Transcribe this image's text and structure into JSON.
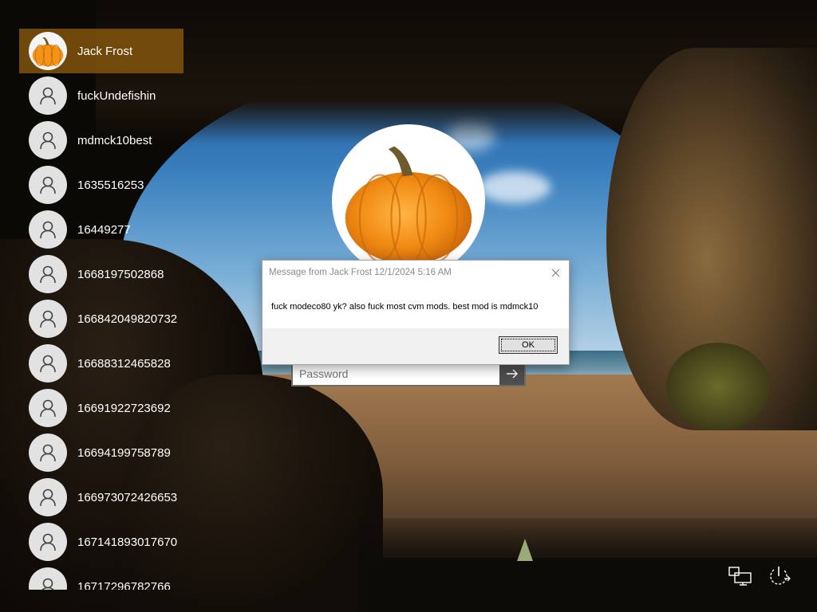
{
  "users": [
    {
      "name": "Jack Frost",
      "selected": true,
      "avatar": "pumpkin"
    },
    {
      "name": "fuckUndefishin",
      "avatar": "person-icon"
    },
    {
      "name": "mdmck10best",
      "avatar": "person-icon"
    },
    {
      "name": "1635516253",
      "avatar": "person-icon"
    },
    {
      "name": "16449277",
      "avatar": "person-icon"
    },
    {
      "name": "1668197502868",
      "avatar": "person-icon"
    },
    {
      "name": "166842049820732",
      "avatar": "person-icon"
    },
    {
      "name": "16688312465828",
      "avatar": "person-icon"
    },
    {
      "name": "16691922723692",
      "avatar": "person-icon"
    },
    {
      "name": "16694199758789",
      "avatar": "person-icon"
    },
    {
      "name": "166973072426653",
      "avatar": "person-icon"
    },
    {
      "name": "167141893017670",
      "avatar": "person-icon"
    },
    {
      "name": "16717296782766",
      "avatar": "person-icon"
    }
  ],
  "login": {
    "password_placeholder": "Password",
    "submit_icon": "arrow-right-icon"
  },
  "dialog": {
    "title": "Message from Jack Frost 12/1/2024 5:16 AM",
    "message": "fuck modeco80 yk? also fuck most cvm mods. best mod is mdmck10",
    "ok_label": "OK"
  },
  "corner_icons": [
    "network-icon",
    "power-icon"
  ],
  "colors": {
    "selected_user_bg": "#784e0c",
    "dialog_bg": "#f0f0f0",
    "submit_bg": "#4e4e4e"
  }
}
